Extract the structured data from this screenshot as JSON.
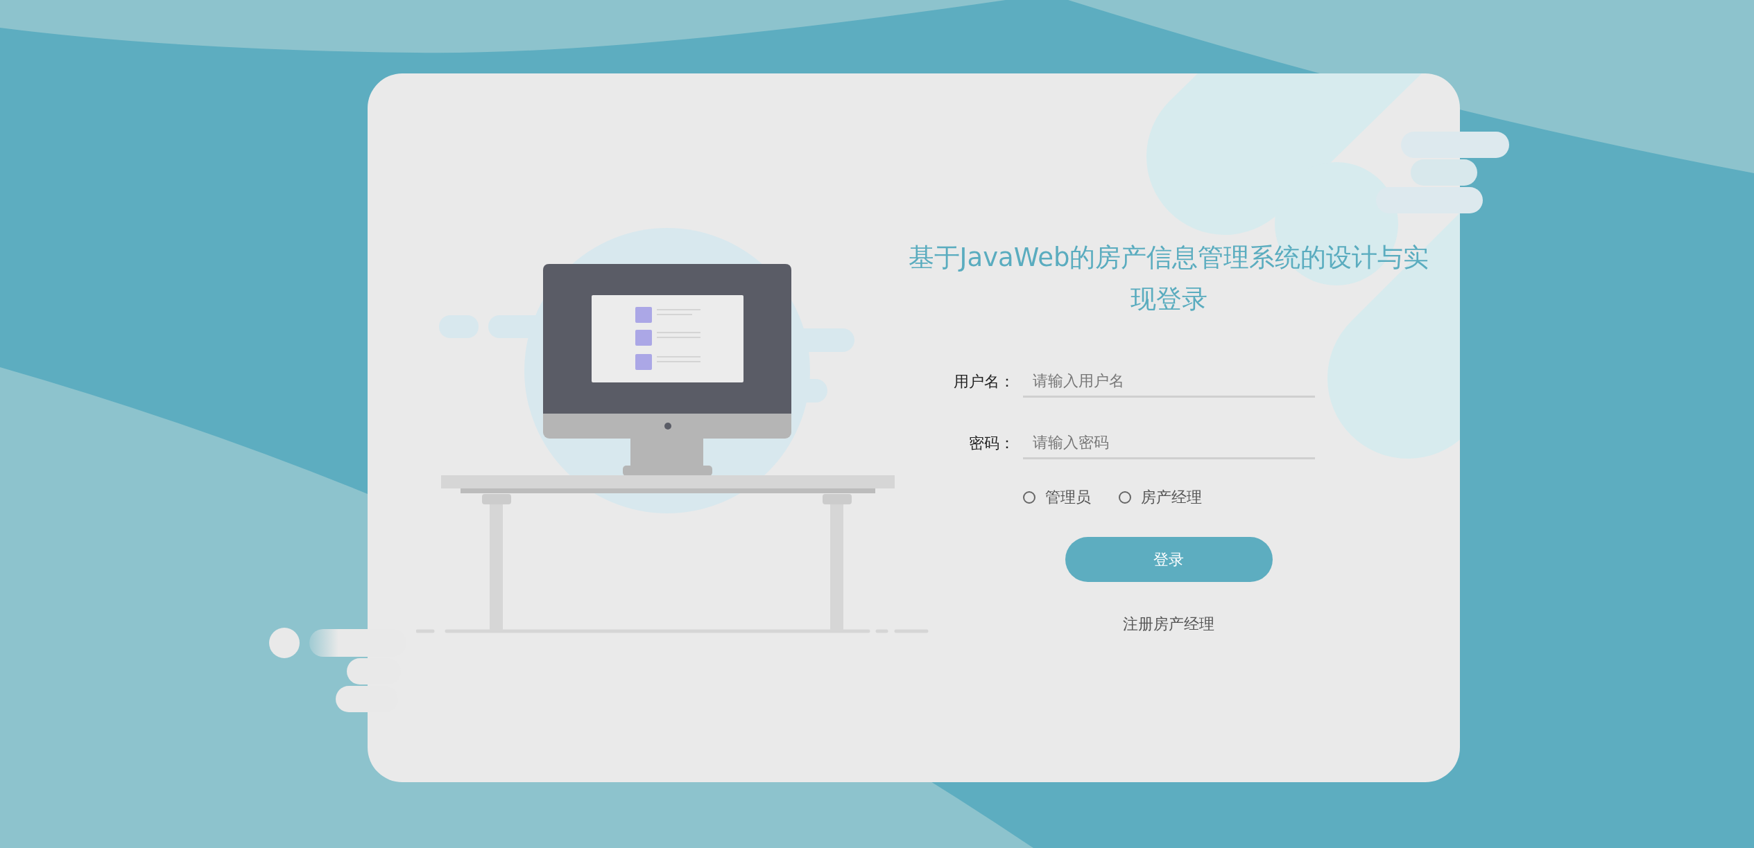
{
  "title": "基于JavaWeb的房产信息管理系统的设计与实现登录",
  "fields": [
    {
      "label": "用户名：",
      "placeholder": "请输入用户名"
    },
    {
      "label": "密码：",
      "placeholder": "请输入密码"
    }
  ],
  "roles": [
    {
      "label": "管理员",
      "selected": false
    },
    {
      "label": "房产经理",
      "selected": false
    }
  ],
  "login_button": "登录",
  "register_link": "注册房产经理"
}
